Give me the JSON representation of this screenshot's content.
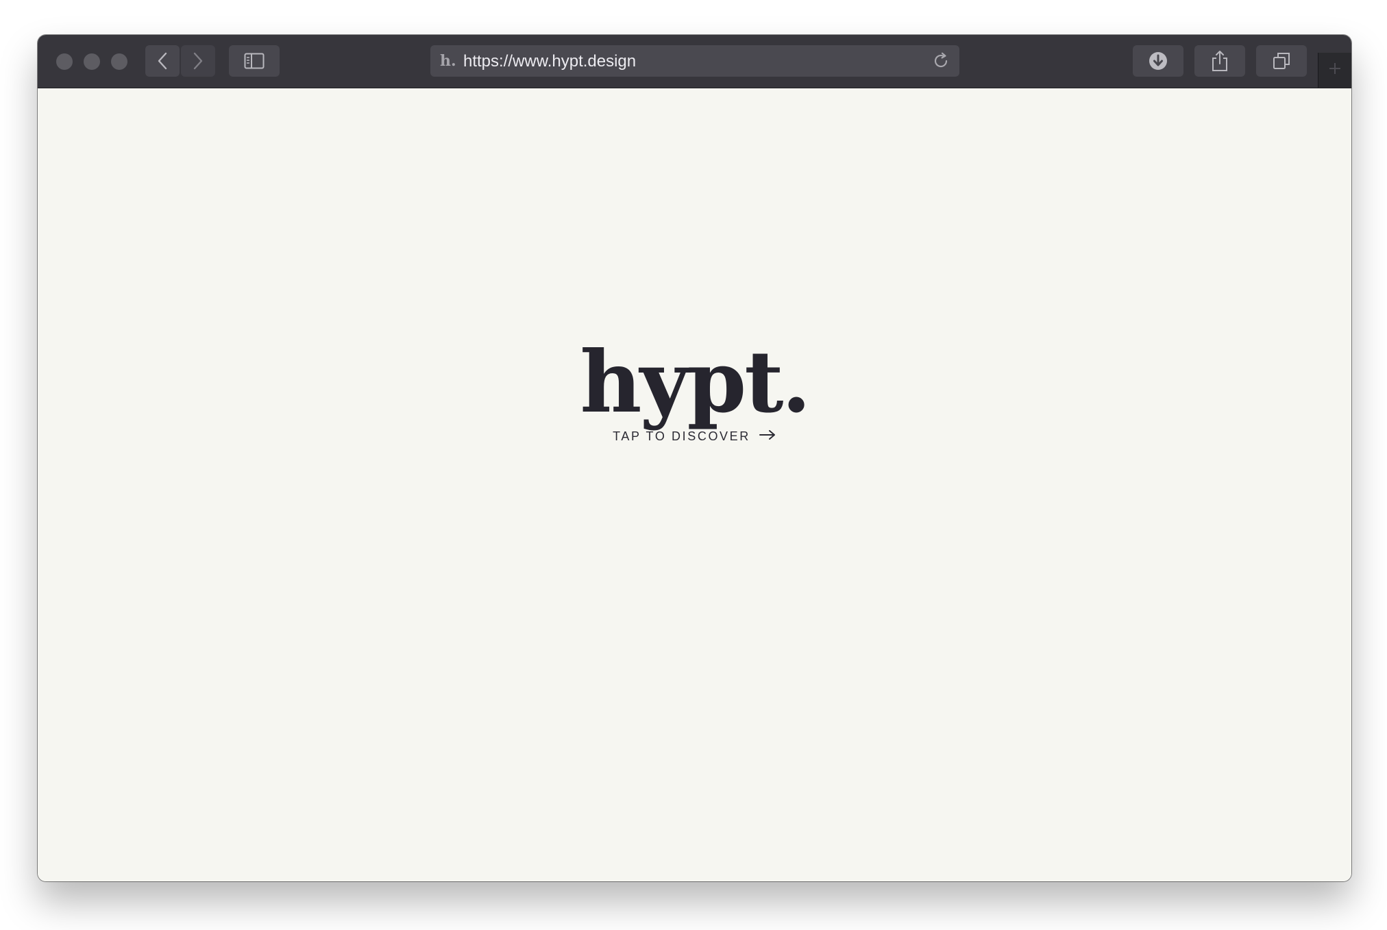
{
  "browser": {
    "favicon": "h.",
    "url": "https://www.hypt.design",
    "icons": {
      "back": "chevron-left-icon",
      "forward": "chevron-right-icon",
      "sidebar": "sidebar-icon",
      "reload": "reload-icon",
      "downloads": "download-icon",
      "share": "share-icon",
      "tabs": "tabs-overview-icon",
      "new_tab": "plus-icon"
    }
  },
  "page": {
    "logo": "hypt.",
    "cta_label": "TAP TO DISCOVER",
    "cta_icon": "arrow-right-icon"
  },
  "colors": {
    "toolbar": "#37363c",
    "page_background": "#f6f6f1",
    "logo_text": "#26252e"
  }
}
